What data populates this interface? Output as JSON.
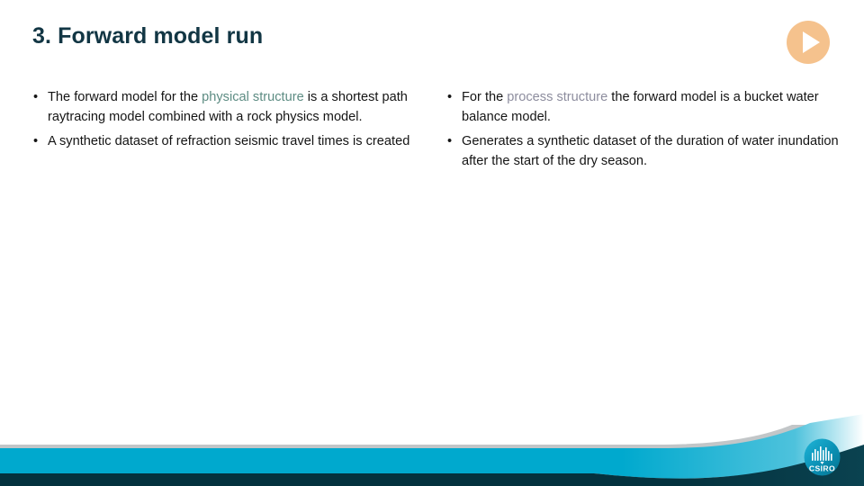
{
  "slide": {
    "title": "3. Forward model run",
    "bullet_glyph": "•"
  },
  "play_badge": {
    "icon": "play-circle-icon",
    "color": "#f5c28d"
  },
  "left_column": {
    "bullets": [
      {
        "segments": [
          {
            "text": "The forward model for the ",
            "style": "normal"
          },
          {
            "text": "physical structure",
            "style": "highlight-teal"
          },
          {
            "text": " is a shortest path raytracing model combined with a rock physics model.",
            "style": "normal"
          }
        ]
      },
      {
        "segments": [
          {
            "text": "A synthetic dataset of refraction seismic travel times is created",
            "style": "normal"
          }
        ]
      }
    ]
  },
  "right_column": {
    "bullets": [
      {
        "segments": [
          {
            "text": "For the ",
            "style": "normal"
          },
          {
            "text": "process structure",
            "style": "highlight-gray"
          },
          {
            "text": " the forward model is a bucket water balance model.",
            "style": "normal"
          }
        ]
      },
      {
        "segments": [
          {
            "text": "Generates a synthetic dataset of the duration of water inundation after the start of the dry season.",
            "style": "normal"
          }
        ]
      }
    ]
  },
  "footer": {
    "logo_text": "CSIRO",
    "logo_name": "csiro-logo",
    "band_cyan": "#00a9ce",
    "band_dark": "#04323e",
    "hairline_gray": "#b7bcbe"
  },
  "colors": {
    "title": "#123644",
    "body_text": "#141414",
    "highlight_teal": "#5d8c83",
    "highlight_gray": "#8d8d9e",
    "background": "#ffffff"
  }
}
